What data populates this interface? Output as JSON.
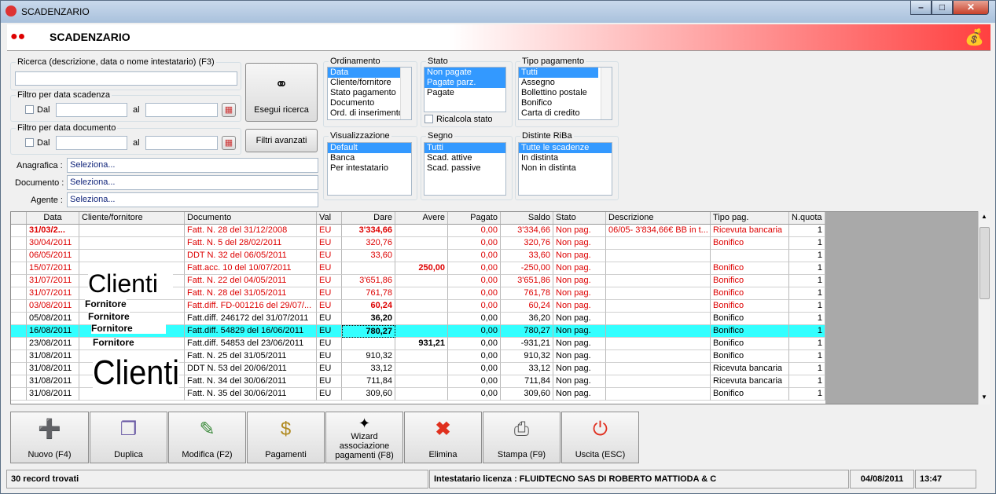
{
  "window": {
    "title": "SCADENZARIO"
  },
  "banner": {
    "title": "SCADENZARIO"
  },
  "search": {
    "label": "Ricerca (descrizione, data o nome intestatario) (F3)",
    "value": "",
    "scadenza_label": "Filtro per data scadenza",
    "documento_label": "Filtro per data documento",
    "dal": "Dal",
    "al": "al",
    "search_button": "Esegui ricerca",
    "advanced_button": "Filtri avanzati"
  },
  "fields": {
    "anagrafica_label": "Anagrafica :",
    "anagrafica_value": "Seleziona...",
    "documento_label": "Documento :",
    "documento_value": "Seleziona...",
    "agente_label": "Agente :",
    "agente_value": "Seleziona..."
  },
  "lists": {
    "ordinamento": {
      "label": "Ordinamento",
      "items": [
        "Data",
        "Cliente/fornitore",
        "Stato pagamento",
        "Documento",
        "Ord. di inserimento"
      ]
    },
    "stato": {
      "label": "Stato",
      "items": [
        "Non pagate",
        "Pagate parz.",
        "Pagate"
      ],
      "ricalcola": "Ricalcola stato"
    },
    "tipo_pagamento": {
      "label": "Tipo pagamento",
      "items": [
        "Tutti",
        "Assegno",
        "Bollettino postale",
        "Bonifico",
        "Carta di credito"
      ]
    },
    "visualizzazione": {
      "label": "Visualizzazione",
      "items": [
        "Default",
        "Banca",
        "Per intestatario"
      ]
    },
    "segno": {
      "label": "Segno",
      "items": [
        "Tutti",
        "Scad. attive",
        "Scad. passive"
      ]
    },
    "distinte": {
      "label": "Distinte RiBa",
      "items": [
        "Tutte le scadenze",
        "In distinta",
        "Non in distinta"
      ]
    }
  },
  "grid": {
    "headers": [
      "Data",
      "Cliente/fornitore",
      "Documento",
      "Val",
      "Dare",
      "Avere",
      "Pagato",
      "Saldo",
      "Stato",
      "Descrizione",
      "Tipo pag.",
      "N.quota"
    ],
    "rows": [
      {
        "data": "31/03/2...",
        "cli": "",
        "doc": "Fatt. N. 28 del 31/12/2008",
        "val": "EU",
        "dare": "3'334,66",
        "avere": "",
        "pagato": "0,00",
        "saldo": "3'334,66",
        "stato": "Non pag.",
        "descr": "06/05- 3'834,66€ BB in t...",
        "tipo": "Ricevuta bancaria",
        "quota": "1"
      },
      {
        "data": "30/04/2011",
        "cli": "",
        "doc": "Fatt. N. 5 del 28/02/2011",
        "val": "EU",
        "dare": "320,76",
        "avere": "",
        "pagato": "0,00",
        "saldo": "320,76",
        "stato": "Non pag.",
        "descr": "",
        "tipo": "Bonifico",
        "quota": "1"
      },
      {
        "data": "06/05/2011",
        "cli": "",
        "doc": "DDT N. 32 del 06/05/2011",
        "val": "EU",
        "dare": "33,60",
        "avere": "",
        "pagato": "0,00",
        "saldo": "33,60",
        "stato": "Non pag.",
        "descr": "",
        "tipo": "",
        "quota": "1"
      },
      {
        "data": "15/07/2011",
        "cli": "",
        "doc": "Fatt.acc. 10 del 10/07/2011",
        "val": "EU",
        "dare": "",
        "avere": "250,00",
        "pagato": "0,00",
        "saldo": "-250,00",
        "stato": "Non pag.",
        "descr": "",
        "tipo": "Bonifico",
        "quota": "1"
      },
      {
        "data": "31/07/2011",
        "cli": "",
        "doc": "Fatt. N. 22 del 04/05/2011",
        "val": "EU",
        "dare": "3'651,86",
        "avere": "",
        "pagato": "0,00",
        "saldo": "3'651,86",
        "stato": "Non pag.",
        "descr": "",
        "tipo": "Bonifico",
        "quota": "1"
      },
      {
        "data": "31/07/2011",
        "cli": "",
        "doc": "Fatt. N. 28 del 31/05/2011",
        "val": "EU",
        "dare": "761,78",
        "avere": "",
        "pagato": "0,00",
        "saldo": "761,78",
        "stato": "Non pag.",
        "descr": "",
        "tipo": "Bonifico",
        "quota": "1"
      },
      {
        "data": "03/08/2011",
        "cli": "",
        "doc": "Fatt.diff. FD-001216 del 29/07/...",
        "val": "EU",
        "dare": "60,24",
        "avere": "",
        "pagato": "0,00",
        "saldo": "60,24",
        "stato": "Non pag.",
        "descr": "",
        "tipo": "Bonifico",
        "quota": "1"
      },
      {
        "data": "05/08/2011",
        "cli": "",
        "doc": "Fatt.diff. 246172 del 31/07/2011",
        "val": "EU",
        "dare": "36,20",
        "avere": "",
        "pagato": "0,00",
        "saldo": "36,20",
        "stato": "Non pag.",
        "descr": "",
        "tipo": "Bonifico",
        "quota": "1"
      },
      {
        "data": "16/08/2011",
        "cli": "",
        "doc": "Fatt.diff. 54829 del 16/06/2011",
        "val": "EU",
        "dare": "780,27",
        "avere": "",
        "pagato": "0,00",
        "saldo": "780,27",
        "stato": "Non pag.",
        "descr": "",
        "tipo": "Bonifico",
        "quota": "1"
      },
      {
        "data": "23/08/2011",
        "cli": "",
        "doc": "Fatt.diff. 54853 del 23/06/2011",
        "val": "EU",
        "dare": "",
        "avere": "931,21",
        "pagato": "0,00",
        "saldo": "-931,21",
        "stato": "Non pag.",
        "descr": "",
        "tipo": "Bonifico",
        "quota": "1"
      },
      {
        "data": "31/08/2011",
        "cli": "",
        "doc": "Fatt. N. 25 del 31/05/2011",
        "val": "EU",
        "dare": "910,32",
        "avere": "",
        "pagato": "0,00",
        "saldo": "910,32",
        "stato": "Non pag.",
        "descr": "",
        "tipo": "Bonifico",
        "quota": "1"
      },
      {
        "data": "31/08/2011",
        "cli": "",
        "doc": "DDT N. 53 del 20/06/2011",
        "val": "EU",
        "dare": "33,12",
        "avere": "",
        "pagato": "0,00",
        "saldo": "33,12",
        "stato": "Non pag.",
        "descr": "",
        "tipo": "Ricevuta bancaria",
        "quota": "1"
      },
      {
        "data": "31/08/2011",
        "cli": "",
        "doc": "Fatt. N. 34 del 30/06/2011",
        "val": "EU",
        "dare": "711,84",
        "avere": "",
        "pagato": "0,00",
        "saldo": "711,84",
        "stato": "Non pag.",
        "descr": "",
        "tipo": "Ricevuta bancaria",
        "quota": "1"
      },
      {
        "data": "31/08/2011",
        "cli": "",
        "doc": "Fatt. N. 35 del 30/06/2011",
        "val": "EU",
        "dare": "309,60",
        "avere": "",
        "pagato": "0,00",
        "saldo": "309,60",
        "stato": "Non pag.",
        "descr": "",
        "tipo": "Bonifico",
        "quota": "1"
      }
    ],
    "watermarks": [
      "Clienti",
      "Fornitore",
      "Fornitore",
      "Fornitore",
      "Fornitore",
      "Clienti"
    ]
  },
  "toolbar": {
    "nuovo": "Nuovo (F4)",
    "duplica": "Duplica",
    "modifica": "Modifica (F2)",
    "pagamenti": "Pagamenti",
    "wizard": "Wizard associazione pagamenti (F8)",
    "elimina": "Elimina",
    "stampa": "Stampa (F9)",
    "uscita": "Uscita (ESC)"
  },
  "status": {
    "records": "30 record trovati",
    "license": "Intestatario licenza : FLUIDTECNO SAS DI ROBERTO MATTIODA & C",
    "date": "04/08/2011",
    "time": "13:47"
  }
}
